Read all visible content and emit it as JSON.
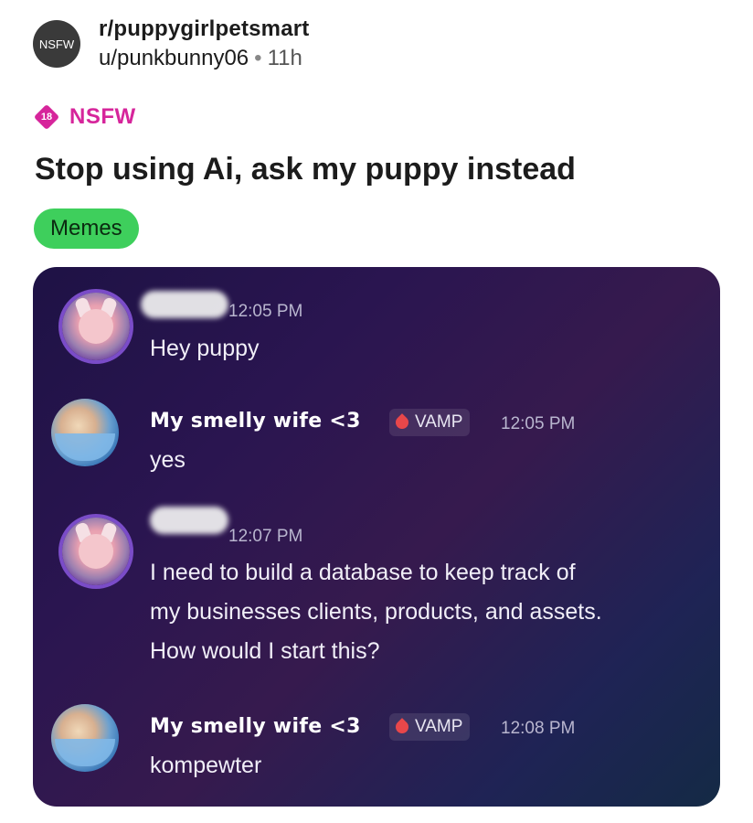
{
  "header": {
    "subreddit_icon_text": "NSFW",
    "subreddit": "r/puppygirlpetsmart",
    "author": "u/punkbunny06",
    "separator": "•",
    "age": "11h"
  },
  "nsfw": {
    "badge": "18",
    "label": "NSFW"
  },
  "post": {
    "title": "Stop using Ai, ask my puppy instead",
    "flair": "Memes"
  },
  "chat": {
    "messages": [
      {
        "time": "12:05 PM",
        "text": "Hey puppy"
      },
      {
        "username": "My smelly wife <3",
        "role": "VAMP",
        "time": "12:05 PM",
        "text": "yes"
      },
      {
        "time": "12:07 PM",
        "lines": [
          "I need to build a database to keep track of",
          "my businesses clients, products, and assets.",
          "How would I start this?"
        ]
      },
      {
        "username": "My smelly wife <3",
        "role": "VAMP",
        "time": "12:08 PM",
        "text": "kompewter"
      }
    ]
  },
  "colors": {
    "nsfw": "#d6259b",
    "flair": "#3ecf5c",
    "role_icon": "#e8474a"
  },
  "icons": {
    "subreddit_avatar": "nsfw-subreddit-icon",
    "nsfw_badge": "18-diamond-icon",
    "role": "blood-drop-icon"
  }
}
